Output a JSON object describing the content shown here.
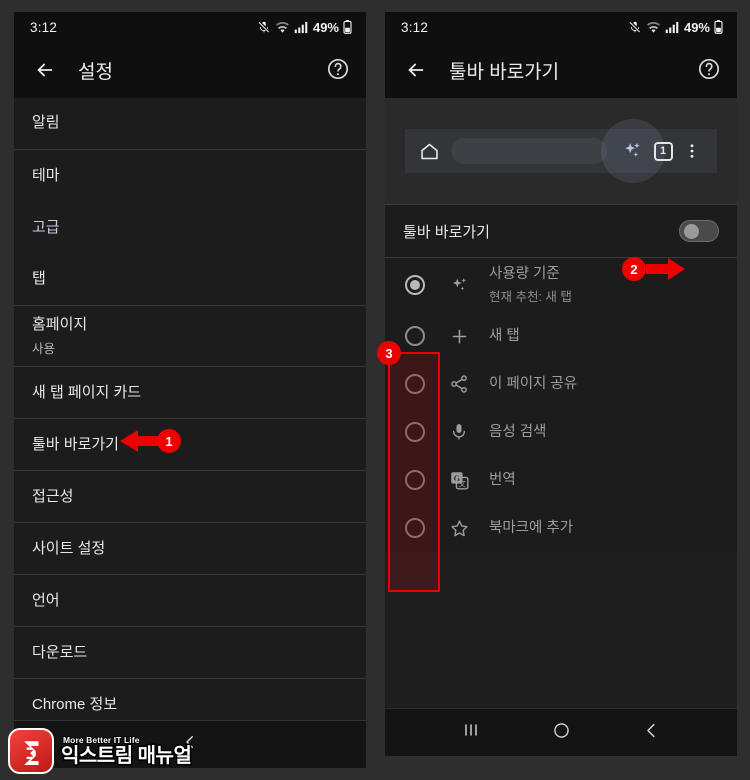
{
  "status_bar": {
    "time": "3:12",
    "battery_percent": "49%",
    "icons": [
      "mic-off-icon",
      "wifi-icon",
      "signal-bars-icon",
      "battery-icon"
    ]
  },
  "left_phone": {
    "appbar": {
      "back_icon": "arrow-left-icon",
      "title": "설정",
      "help_icon": "help-circle-icon"
    },
    "items": [
      {
        "label": "알림",
        "sub": "",
        "style": "normal",
        "group_end": true
      },
      {
        "label": "테마",
        "sub": "",
        "style": "normal",
        "group_end": false
      },
      {
        "label": "고급",
        "sub": "",
        "style": "link",
        "group_end": false
      },
      {
        "label": "탭",
        "sub": "",
        "style": "normal",
        "group_end": true
      },
      {
        "label": "홈페이지",
        "sub": "사용",
        "style": "normal",
        "group_end": true
      },
      {
        "label": "새 탭 페이지 카드",
        "sub": "",
        "style": "normal",
        "group_end": true
      },
      {
        "label": "툴바 바로가기",
        "sub": "",
        "style": "normal",
        "group_end": true
      },
      {
        "label": "접근성",
        "sub": "",
        "style": "normal",
        "group_end": true
      },
      {
        "label": "사이트 설정",
        "sub": "",
        "style": "normal",
        "group_end": true
      },
      {
        "label": "언어",
        "sub": "",
        "style": "normal",
        "group_end": true
      },
      {
        "label": "다운로드",
        "sub": "",
        "style": "normal",
        "group_end": true
      },
      {
        "label": "Chrome 정보",
        "sub": "",
        "style": "normal",
        "group_end": true
      }
    ],
    "bottom_bar": {
      "back_icon": "chevron-left-icon"
    }
  },
  "right_phone": {
    "appbar": {
      "back_icon": "arrow-left-icon",
      "title": "툴바 바로가기",
      "help_icon": "help-circle-icon"
    },
    "toolbar_preview": {
      "home_icon": "home-icon",
      "url_bar": "",
      "sparkle_icon": "sparkle-ai-icon",
      "tab_count": "1",
      "menu_icon": "three-dot-menu-icon"
    },
    "toggle": {
      "label": "툴바 바로가기",
      "state": "off"
    },
    "options": [
      {
        "title": "사용량 기준",
        "sub": "현재 추천: 새 탭",
        "icon": "sparkle-ai-icon",
        "selected": true
      },
      {
        "title": "새 탭",
        "sub": "",
        "icon": "plus-icon",
        "selected": false
      },
      {
        "title": "이 페이지 공유",
        "sub": "",
        "icon": "share-icon",
        "selected": false
      },
      {
        "title": "음성 검색",
        "sub": "",
        "icon": "microphone-icon",
        "selected": false
      },
      {
        "title": "번역",
        "sub": "",
        "icon": "translate-icon",
        "selected": false
      },
      {
        "title": "북마크에 추가",
        "sub": "",
        "icon": "star-outline-icon",
        "selected": false
      }
    ],
    "nav_bar": {
      "recents_icon": "recent-apps-icon",
      "home_icon": "home-circle-icon",
      "back_icon": "chevron-left-icon"
    }
  },
  "annotations": {
    "markers": [
      {
        "number": "1"
      },
      {
        "number": "2"
      },
      {
        "number": "3"
      }
    ],
    "accent_color": "#ee0000"
  },
  "watermark": {
    "tagline": "More Better IT Life",
    "name": "익스트림 매뉴얼",
    "logo_letter": "ƸX"
  }
}
